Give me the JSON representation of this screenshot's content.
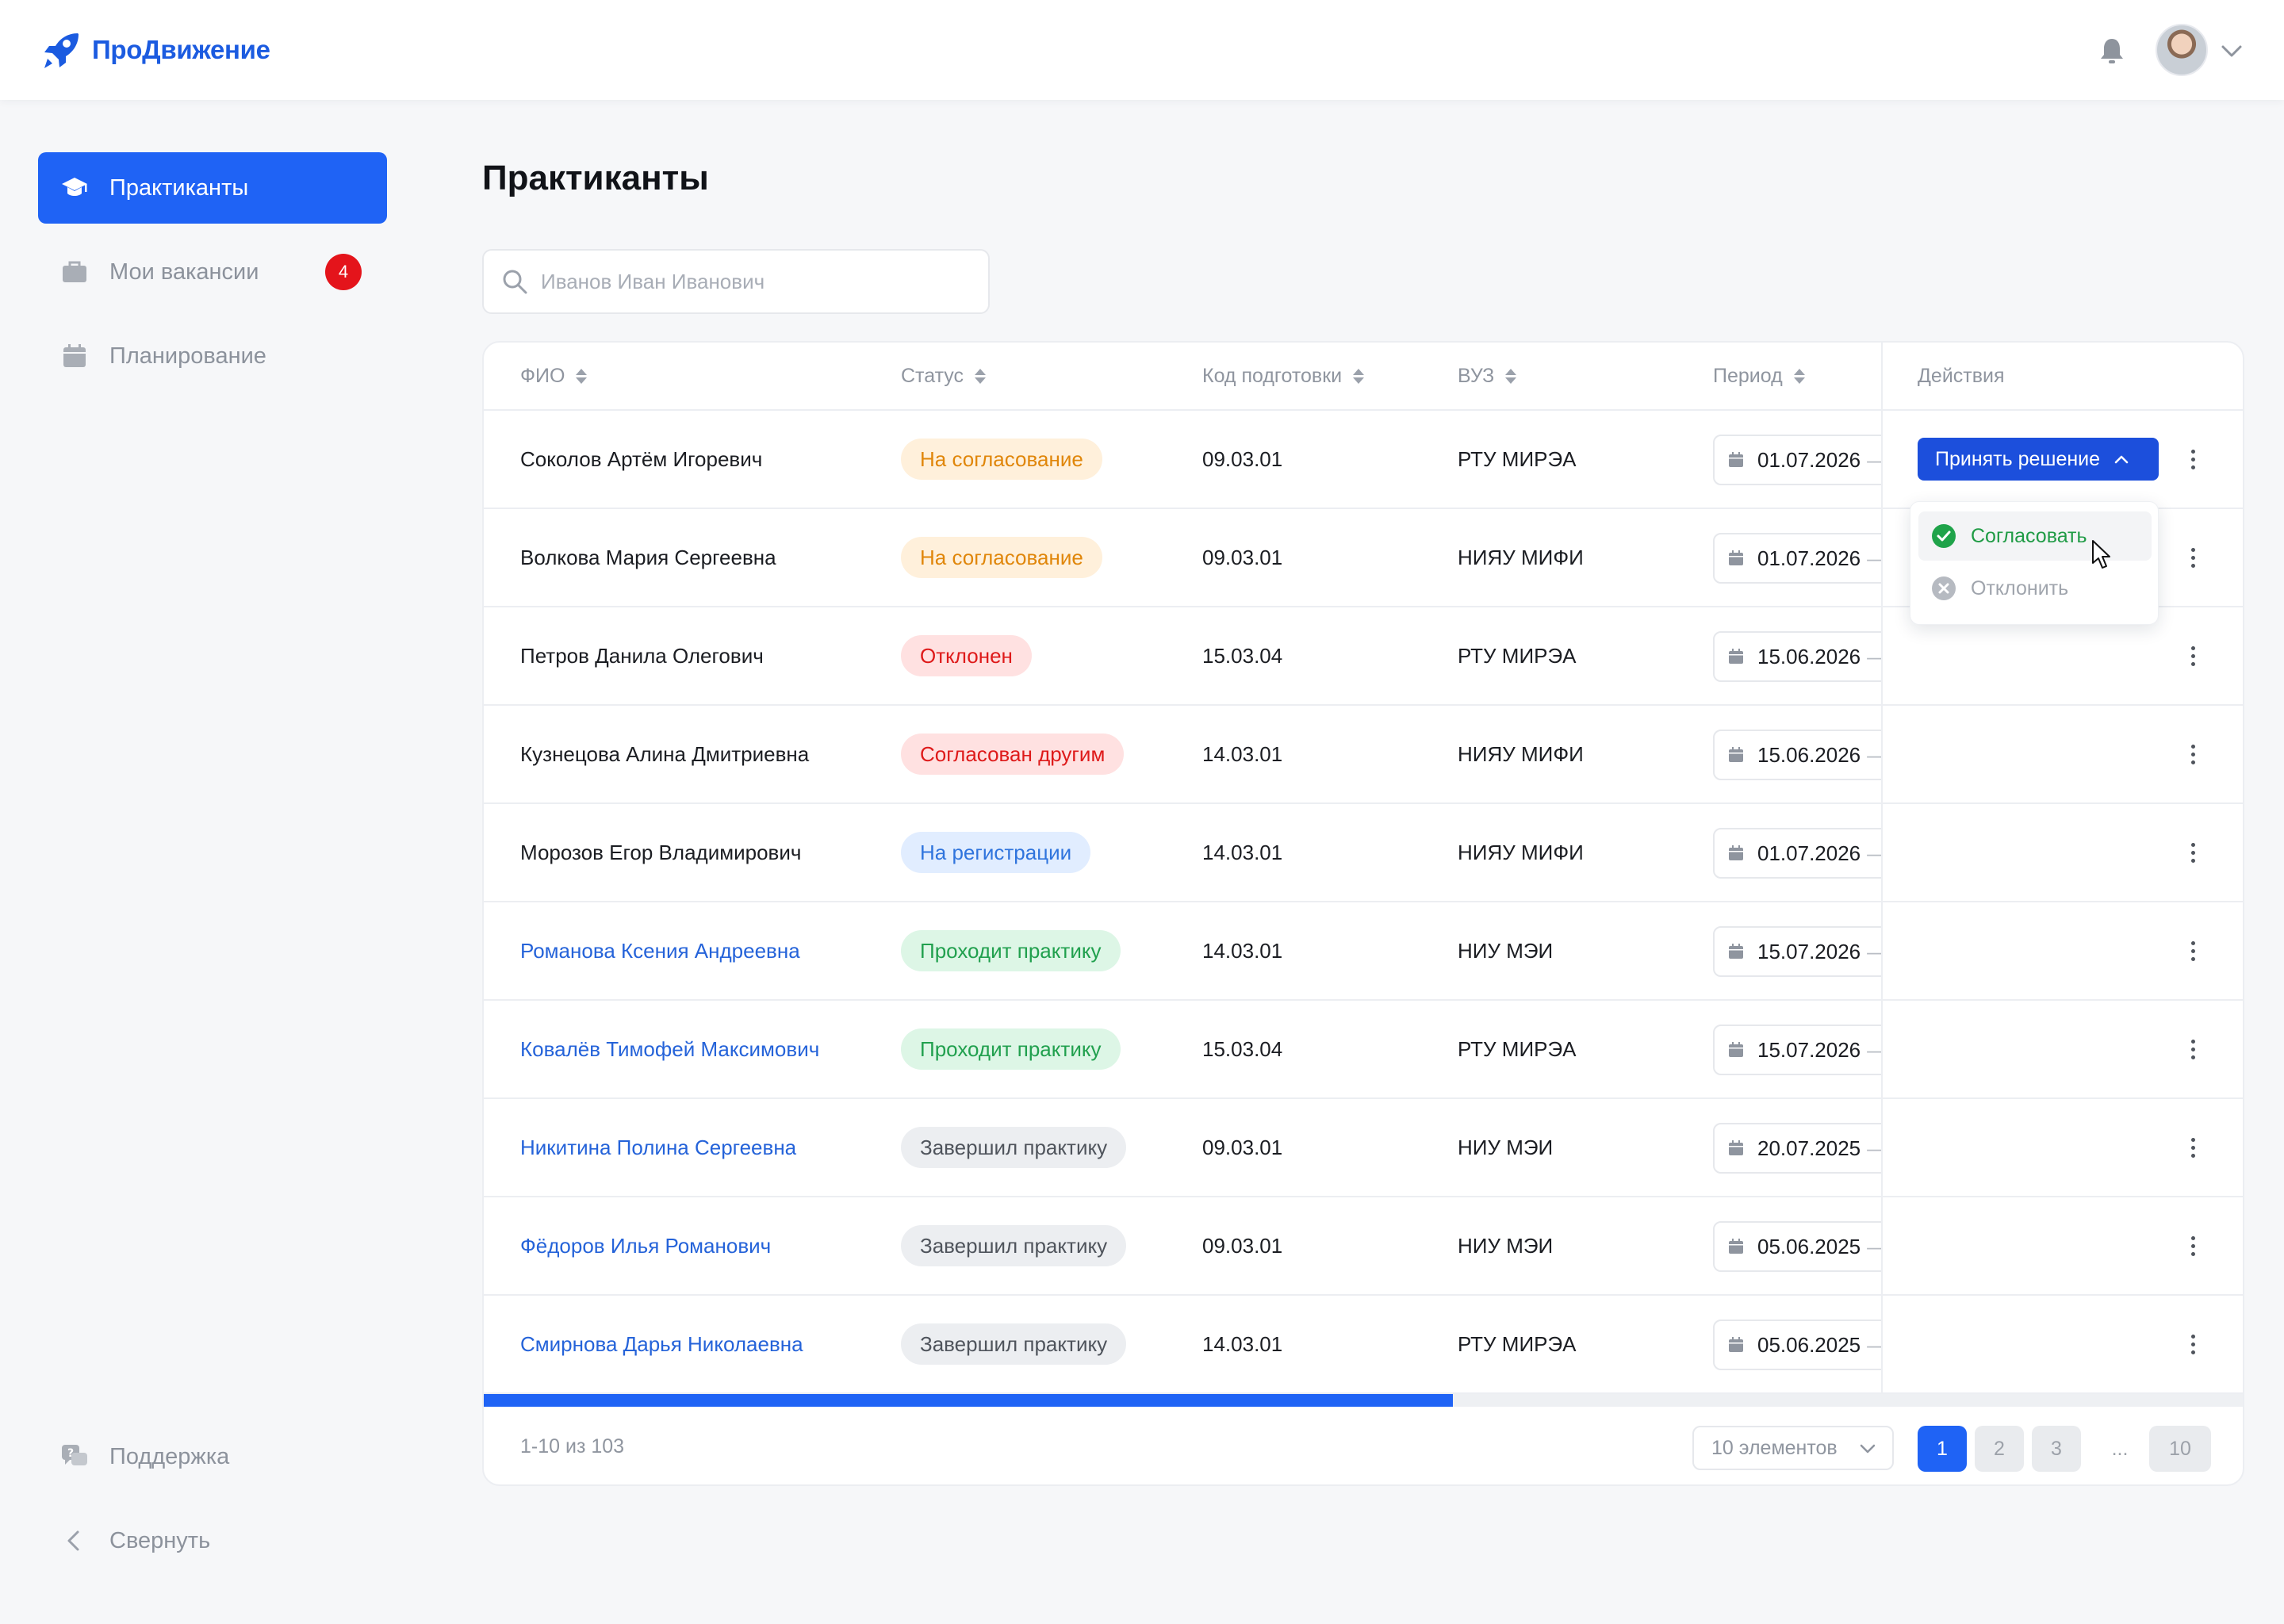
{
  "app": {
    "name": "ПроДвижение"
  },
  "sidebar": {
    "items": [
      {
        "label": "Практиканты",
        "active": true
      },
      {
        "label": "Мои вакансии",
        "badge": "4"
      },
      {
        "label": "Планирование"
      }
    ],
    "bottom": [
      {
        "label": "Поддержка"
      },
      {
        "label": "Свернуть"
      }
    ]
  },
  "main": {
    "title": "Практиканты",
    "search_placeholder": "Иванов Иван Иванович",
    "columns": [
      "ФИО",
      "Статус",
      "Код подготовки",
      "ВУЗ",
      "Период",
      "Действия"
    ],
    "rows": [
      {
        "name": "Соколов Артём Игоревич",
        "link": false,
        "status": "На согласование",
        "status_kind": "pending",
        "code": "09.03.01",
        "uni": "РТУ МИРЭА",
        "period_start": "01.07.2026"
      },
      {
        "name": "Волкова Мария Сергеевна",
        "link": false,
        "status": "На согласование",
        "status_kind": "pending",
        "code": "09.03.01",
        "uni": "НИЯУ МИФИ",
        "period_start": "01.07.2026"
      },
      {
        "name": "Петров Данила Олегович",
        "link": false,
        "status": "Отклонен",
        "status_kind": "rejected",
        "code": "15.03.04",
        "uni": "РТУ МИРЭА",
        "period_start": "15.06.2026"
      },
      {
        "name": "Кузнецова Алина Дмитриевна",
        "link": false,
        "status": "Согласован другим",
        "status_kind": "rejected",
        "code": "14.03.01",
        "uni": "НИЯУ МИФИ",
        "period_start": "15.06.2026"
      },
      {
        "name": "Морозов Егор Владимирович",
        "link": false,
        "status": "На регистрации",
        "status_kind": "reg",
        "code": "14.03.01",
        "uni": "НИЯУ МИФИ",
        "period_start": "01.07.2026"
      },
      {
        "name": "Романова Ксения Андреевна",
        "link": true,
        "status": "Проходит практику",
        "status_kind": "active",
        "code": "14.03.01",
        "uni": "НИУ МЭИ",
        "period_start": "15.07.2026"
      },
      {
        "name": "Ковалёв Тимофей Максимович",
        "link": true,
        "status": "Проходит практику",
        "status_kind": "active",
        "code": "15.03.04",
        "uni": "РТУ МИРЭА",
        "period_start": "15.07.2026"
      },
      {
        "name": "Никитина Полина Сергеевна",
        "link": true,
        "status": "Завершил практику",
        "status_kind": "done",
        "code": "09.03.01",
        "uni": "НИУ МЭИ",
        "period_start": "20.07.2025"
      },
      {
        "name": "Фёдоров Илья Романович",
        "link": true,
        "status": "Завершил практику",
        "status_kind": "done",
        "code": "09.03.01",
        "uni": "НИУ МЭИ",
        "period_start": "05.06.2025"
      },
      {
        "name": "Смирнова Дарья Николаевна",
        "link": true,
        "status": "Завершил практику",
        "status_kind": "done",
        "code": "14.03.01",
        "uni": "РТУ МИРЭА",
        "period_start": "05.06.2025"
      }
    ],
    "decision_button": "Принять решение",
    "dropdown": {
      "approve": "Согласовать",
      "reject": "Отклонить"
    },
    "scroll_fraction": 0.55,
    "footer": {
      "range": "1-10 из 103",
      "per_page": "10 элементов",
      "pages": [
        "1",
        "2",
        "3",
        "...",
        "10"
      ],
      "current_page": "1"
    }
  },
  "colors": {
    "accent": "#1f63f5",
    "brand": "#1b5be0",
    "badge": "#e4141b"
  }
}
